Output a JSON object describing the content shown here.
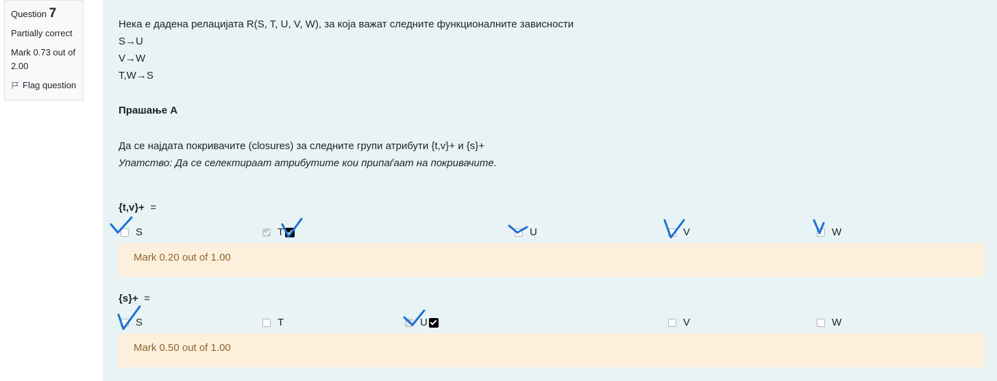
{
  "info": {
    "question_label": "Question",
    "question_number": "7",
    "state": "Partially correct",
    "grade": "Mark 0.73 out of 2.00",
    "flag_label": "Flag question"
  },
  "question": {
    "intro": "Нека е дадена релацијата R(S, T, U, V, W), за која важат следните функционалните зависности",
    "deps": [
      "S→U",
      "V→W",
      "T,W→S"
    ],
    "part_title": "Прашање А",
    "task": "Да се најдата покривачите (closures) за следните групи атрибути {t,v}+  и  {s}+",
    "hint": "Упатство: Да се селектираат атрибутите кои припаѓаат на покривачите."
  },
  "subquestions": [
    {
      "label": "{t,v}+",
      "equals": "=",
      "options": [
        {
          "label": "S",
          "checked": false,
          "correct_mark": false
        },
        {
          "label": "T",
          "checked": true,
          "correct_mark": true
        },
        {
          "label": "U",
          "checked": false,
          "correct_mark": false
        },
        {
          "label": "V",
          "checked": false,
          "correct_mark": false
        },
        {
          "label": "W",
          "checked": false,
          "correct_mark": false
        }
      ],
      "feedback": "Mark 0.20 out of 1.00"
    },
    {
      "label": "{s}+",
      "equals": "=",
      "options": [
        {
          "label": "S",
          "checked": false,
          "correct_mark": false
        },
        {
          "label": "T",
          "checked": false,
          "correct_mark": false
        },
        {
          "label": "U",
          "checked": true,
          "correct_mark": true
        },
        {
          "label": "V",
          "checked": false,
          "correct_mark": false
        },
        {
          "label": "W",
          "checked": false,
          "correct_mark": false
        }
      ],
      "feedback": "Mark 0.50 out of 1.00"
    }
  ],
  "colors": {
    "content_bg": "#e7f3f5",
    "feedback_bg": "#fcefdc",
    "feedback_text": "#8e662e",
    "handwritten_ticks": "#1f6fd0"
  }
}
